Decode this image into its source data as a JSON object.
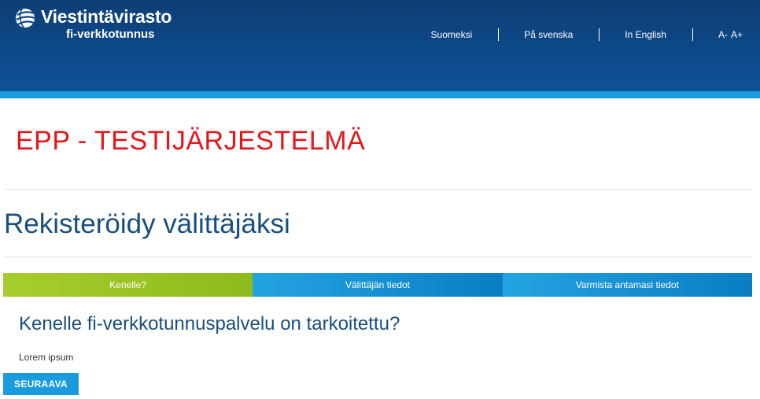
{
  "header": {
    "brand_title": "Viestintävirasto",
    "brand_subtitle": "fi-verkkotunnus",
    "languages": [
      "Suomeksi",
      "På svenska",
      "In English"
    ],
    "font_smaller": "A-",
    "font_larger": "A+"
  },
  "banner": {
    "text": "EPP - TESTIJÄRJESTELMÄ"
  },
  "page": {
    "title": "Rekisteröidy välittäjäksi"
  },
  "steps": [
    {
      "label": "Kenelle?",
      "active": true
    },
    {
      "label": "Välittäjän tiedot",
      "active": false
    },
    {
      "label": "Varmista antamasi tiedot",
      "active": false
    }
  ],
  "content": {
    "section_title": "Kenelle fi-verkkotunnuspalvelu on tarkoitettu?",
    "body": "Lorem ipsum",
    "next_label": "SEURAAVA"
  },
  "colors": {
    "header": "#0d4a8a",
    "accent": "#1a9bde",
    "active_step": "#a7cd2c",
    "banner_red": "#e5161b",
    "title_blue": "#194f7e"
  }
}
